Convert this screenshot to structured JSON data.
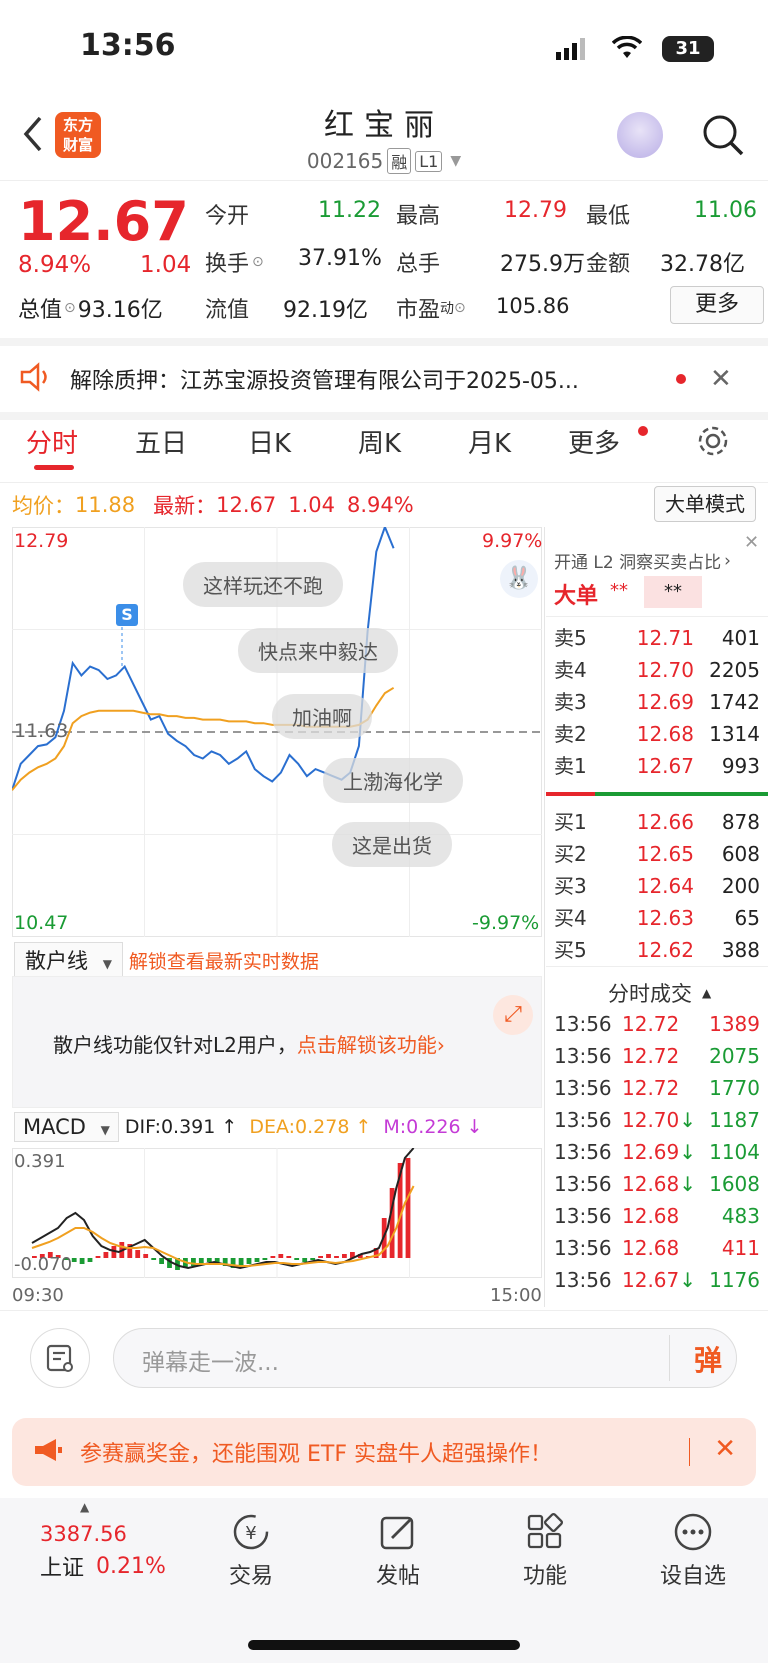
{
  "status_bar": {
    "time": "13:56",
    "battery": "31"
  },
  "header": {
    "logo": "东方\n财富",
    "stock_name": "红宝丽",
    "stock_code": "002165",
    "tag_margin": "融",
    "tag_level": "L1"
  },
  "quote": {
    "price": "12.67",
    "change_pct": "8.94%",
    "change_amt": "1.04",
    "total_value_label": "总值",
    "total_value": "93.16亿",
    "open_label": "今开",
    "open": "11.22",
    "high_label": "最高",
    "high": "12.79",
    "low_label": "最低",
    "low": "11.06",
    "turnover_label": "换手",
    "turnover": "37.91%",
    "volume_label": "总手",
    "volume": "275.9万",
    "amount_label": "金额",
    "amount": "32.78亿",
    "float_label": "流值",
    "float_value": "92.19亿",
    "pe_label": "市盈",
    "pe_sup": "动",
    "pe": "105.86",
    "more_label": "更多"
  },
  "notice": {
    "text": "解除质押：江苏宝源投资管理有限公司于2025-05..."
  },
  "tabs": [
    "分时",
    "五日",
    "日K",
    "周K",
    "月K",
    "更多"
  ],
  "chart_info": {
    "avg_label": "均价：",
    "avg": "11.88",
    "latest_label": "最新：",
    "latest": "12.67",
    "latest_chg": "1.04",
    "latest_pct": "8.94%",
    "big_order_mode": "大单模式"
  },
  "chart_axes": {
    "y_top": "12.79",
    "y_mid": "11.63",
    "y_bottom": "10.47",
    "pct_top": "9.97%",
    "pct_bottom": "-9.97%"
  },
  "chart_data": {
    "type": "line",
    "series": [
      {
        "name": "price",
        "values": [
          11.3,
          11.45,
          11.5,
          11.55,
          11.56,
          11.6,
          11.75,
          12.02,
          11.95,
          12.0,
          11.98,
          11.93,
          11.95,
          12.0,
          11.9,
          11.8,
          11.7,
          11.72,
          11.62,
          11.58,
          11.55,
          11.5,
          11.48,
          11.52,
          11.5,
          11.45,
          11.48,
          11.52,
          11.42,
          11.38,
          11.35,
          11.4,
          11.5,
          11.45,
          11.38,
          11.42,
          11.4,
          11.38,
          11.36,
          11.4,
          11.55,
          12.2,
          12.65,
          12.79,
          12.67
        ]
      },
      {
        "name": "avg",
        "values": [
          11.3,
          11.36,
          11.4,
          11.43,
          11.45,
          11.48,
          11.55,
          11.68,
          11.72,
          11.74,
          11.75,
          11.75,
          11.75,
          11.75,
          11.75,
          11.74,
          11.73,
          11.73,
          11.72,
          11.72,
          11.71,
          11.71,
          11.7,
          11.7,
          11.7,
          11.69,
          11.69,
          11.69,
          11.68,
          11.68,
          11.67,
          11.67,
          11.67,
          11.67,
          11.66,
          11.66,
          11.66,
          11.66,
          11.66,
          11.66,
          11.67,
          11.7,
          11.78,
          11.85,
          11.88
        ]
      }
    ],
    "ylim": [
      10.47,
      12.79
    ],
    "prev_close": 11.63
  },
  "danmaku": [
    "这样玩还不跑",
    "快点来中毅达",
    "加油啊",
    "上渤海化学",
    "这是出货"
  ],
  "orderbook": {
    "l2_hint": "开通 L2 洞察买卖占比",
    "big_order_label": "大单",
    "big_order_left": "**",
    "big_order_right": "**",
    "sells": [
      {
        "label": "卖5",
        "price": "12.71",
        "vol": "401"
      },
      {
        "label": "卖4",
        "price": "12.70",
        "vol": "2205"
      },
      {
        "label": "卖3",
        "price": "12.69",
        "vol": "1742"
      },
      {
        "label": "卖2",
        "price": "12.68",
        "vol": "1314"
      },
      {
        "label": "卖1",
        "price": "12.67",
        "vol": "993"
      }
    ],
    "buys": [
      {
        "label": "买1",
        "price": "12.66",
        "vol": "878"
      },
      {
        "label": "买2",
        "price": "12.65",
        "vol": "608"
      },
      {
        "label": "买3",
        "price": "12.64",
        "vol": "200"
      },
      {
        "label": "买4",
        "price": "12.63",
        "vol": "65"
      },
      {
        "label": "买5",
        "price": "12.62",
        "vol": "388"
      }
    ]
  },
  "ticks": {
    "title": "分时成交",
    "rows": [
      {
        "time": "13:56",
        "price": "12.72",
        "arrow": "",
        "vol": "1389",
        "vc": "red"
      },
      {
        "time": "13:56",
        "price": "12.72",
        "arrow": "",
        "vol": "2075",
        "vc": "green"
      },
      {
        "time": "13:56",
        "price": "12.72",
        "arrow": "",
        "vol": "1770",
        "vc": "green"
      },
      {
        "time": "13:56",
        "price": "12.70",
        "arrow": "↓",
        "vol": "1187",
        "vc": "green"
      },
      {
        "time": "13:56",
        "price": "12.69",
        "arrow": "↓",
        "vol": "1104",
        "vc": "green"
      },
      {
        "time": "13:56",
        "price": "12.68",
        "arrow": "↓",
        "vol": "1608",
        "vc": "green"
      },
      {
        "time": "13:56",
        "price": "12.68",
        "arrow": "",
        "vol": "483",
        "vc": "green"
      },
      {
        "time": "13:56",
        "price": "12.68",
        "arrow": "",
        "vol": "411",
        "vc": "red"
      },
      {
        "time": "13:56",
        "price": "12.67",
        "arrow": "↓",
        "vol": "1176",
        "vc": "green"
      }
    ]
  },
  "retail_line": {
    "label": "散户线",
    "unlock_hint": "解锁查看最新实时数据",
    "desc": "散户线功能仅针对L2用户，",
    "cta": "点击解锁该功能"
  },
  "macd": {
    "label": "MACD",
    "dif": "DIF:0.391 ↑",
    "dea": "DEA:0.278 ↑",
    "m": "M:0.226 ↓",
    "top": "0.391",
    "bottom": "-0.070",
    "time_start": "09:30",
    "time_end": "15:00"
  },
  "danmu_bar": {
    "placeholder": "弹幕走一波...",
    "send": "弹"
  },
  "promo": {
    "text": "参赛赢奖金，还能围观 ETF 实盘牛人超强操作！"
  },
  "bottom_nav": {
    "index_value": "3387.56",
    "index_name": "上证",
    "index_pct": "0.21%",
    "items": [
      "交易",
      "发帖",
      "功能",
      "设自选"
    ]
  }
}
